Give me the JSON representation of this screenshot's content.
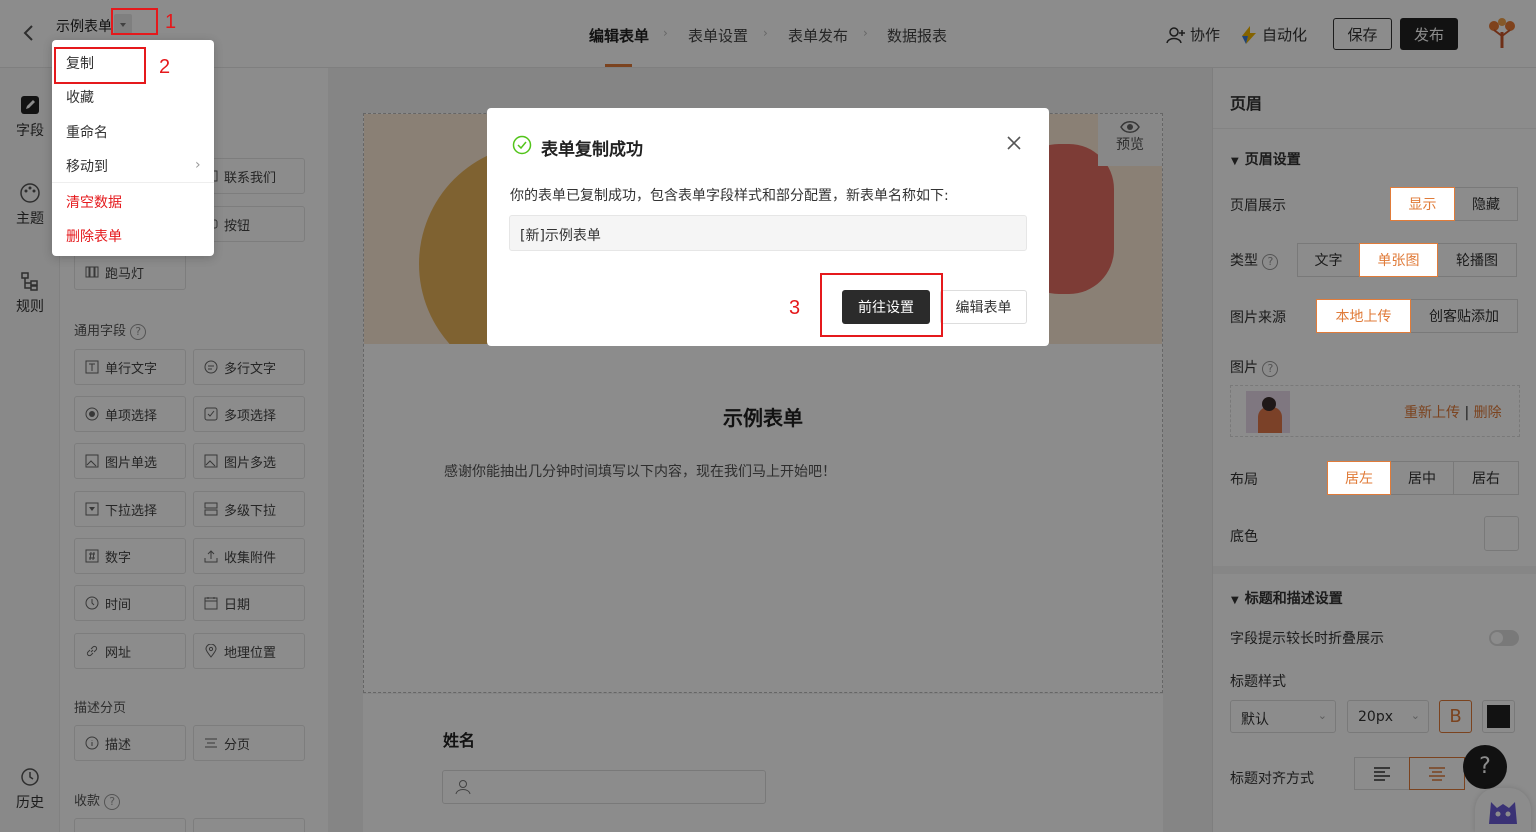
{
  "header": {
    "form_name": "示例表单",
    "steps": [
      "编辑表单",
      "表单设置",
      "表单发布",
      "数据报表"
    ],
    "collab_label": "协作",
    "automation_label": "自动化",
    "save_label": "保存",
    "publish_label": "发布"
  },
  "rail": {
    "fields": "字段",
    "theme": "主题",
    "rules": "规则",
    "history": "历史"
  },
  "field_panel": {
    "top_partial": [
      "联系我们",
      "按钮",
      "跑马灯"
    ],
    "common_title": "通用字段",
    "common": [
      "单行文字",
      "多行文字",
      "单项选择",
      "多项选择",
      "图片单选",
      "图片多选",
      "下拉选择",
      "多级下拉",
      "数字",
      "收集附件",
      "时间",
      "日期",
      "网址",
      "地理位置"
    ],
    "desc_title": "描述分页",
    "desc": [
      "描述",
      "分页"
    ],
    "pay_title": "收款"
  },
  "canvas": {
    "preview_label": "预览",
    "form_title": "示例表单",
    "form_desc": "感谢你能抽出几分钟时间填写以下内容，现在我们马上开始吧！",
    "name_label": "姓名"
  },
  "right_panel": {
    "title": "页眉",
    "header_settings": "页眉设置",
    "display_label": "页眉展示",
    "display_options": [
      "显示",
      "隐藏"
    ],
    "type_label": "类型",
    "type_options": [
      "文字",
      "单张图",
      "轮播图"
    ],
    "source_label": "图片来源",
    "source_options": [
      "本地上传",
      "创客贴添加"
    ],
    "image_label": "图片",
    "reupload": "重新上传",
    "sep": "|",
    "delete": "删除",
    "layout_label": "布局",
    "layout_options": [
      "居左",
      "居中",
      "居右"
    ],
    "bg_label": "底色",
    "title_desc_settings": "标题和描述设置",
    "fold_label": "字段提示较长时折叠展示",
    "title_style_label": "标题样式",
    "font_select": "默认",
    "size_select": "20px",
    "bold_glyph": "B",
    "align_label": "标题对齐方式",
    "help_glyph": "?"
  },
  "dropdown_menu": {
    "items": [
      "复制",
      "收藏",
      "重命名",
      "移动到"
    ],
    "danger_items": [
      "清空数据",
      "删除表单"
    ]
  },
  "modal": {
    "title": "表单复制成功",
    "message": "你的表单已复制成功，包含表单字段样式和部分配置，新表单名称如下:",
    "new_name": "[新]示例表单",
    "go_settings": "前往设置",
    "edit_form": "编辑表单"
  },
  "annotations": [
    "1",
    "2",
    "3"
  ],
  "colors": {
    "accent": "#e07b39",
    "danger": "#e5191c",
    "dark": "#222222"
  }
}
